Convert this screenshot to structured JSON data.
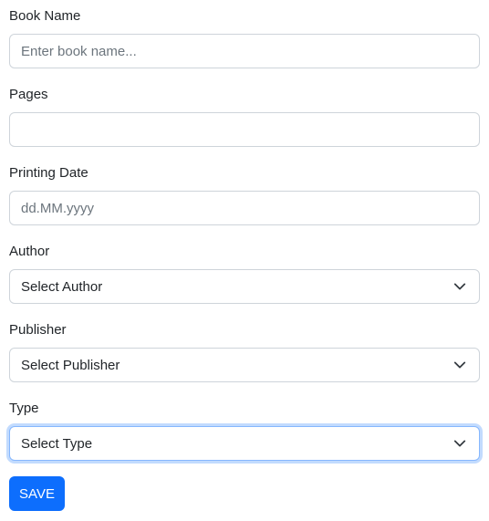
{
  "form": {
    "book_name": {
      "label": "Book Name",
      "placeholder": "Enter book name...",
      "value": ""
    },
    "pages": {
      "label": "Pages",
      "placeholder": "",
      "value": ""
    },
    "printing_date": {
      "label": "Printing Date",
      "placeholder": "dd.MM.yyyy",
      "value": ""
    },
    "author": {
      "label": "Author",
      "selected": "Select Author"
    },
    "publisher": {
      "label": "Publisher",
      "selected": "Select Publisher"
    },
    "type": {
      "label": "Type",
      "selected": "Select Type"
    },
    "save_label": "SAVE"
  },
  "icons": {
    "select_arrow": "chevron-down-icon"
  },
  "colors": {
    "primary": "#0d6efd",
    "border": "#ced4da",
    "focus_border": "#86b7fe",
    "text": "#212529",
    "placeholder": "#6c757d"
  }
}
